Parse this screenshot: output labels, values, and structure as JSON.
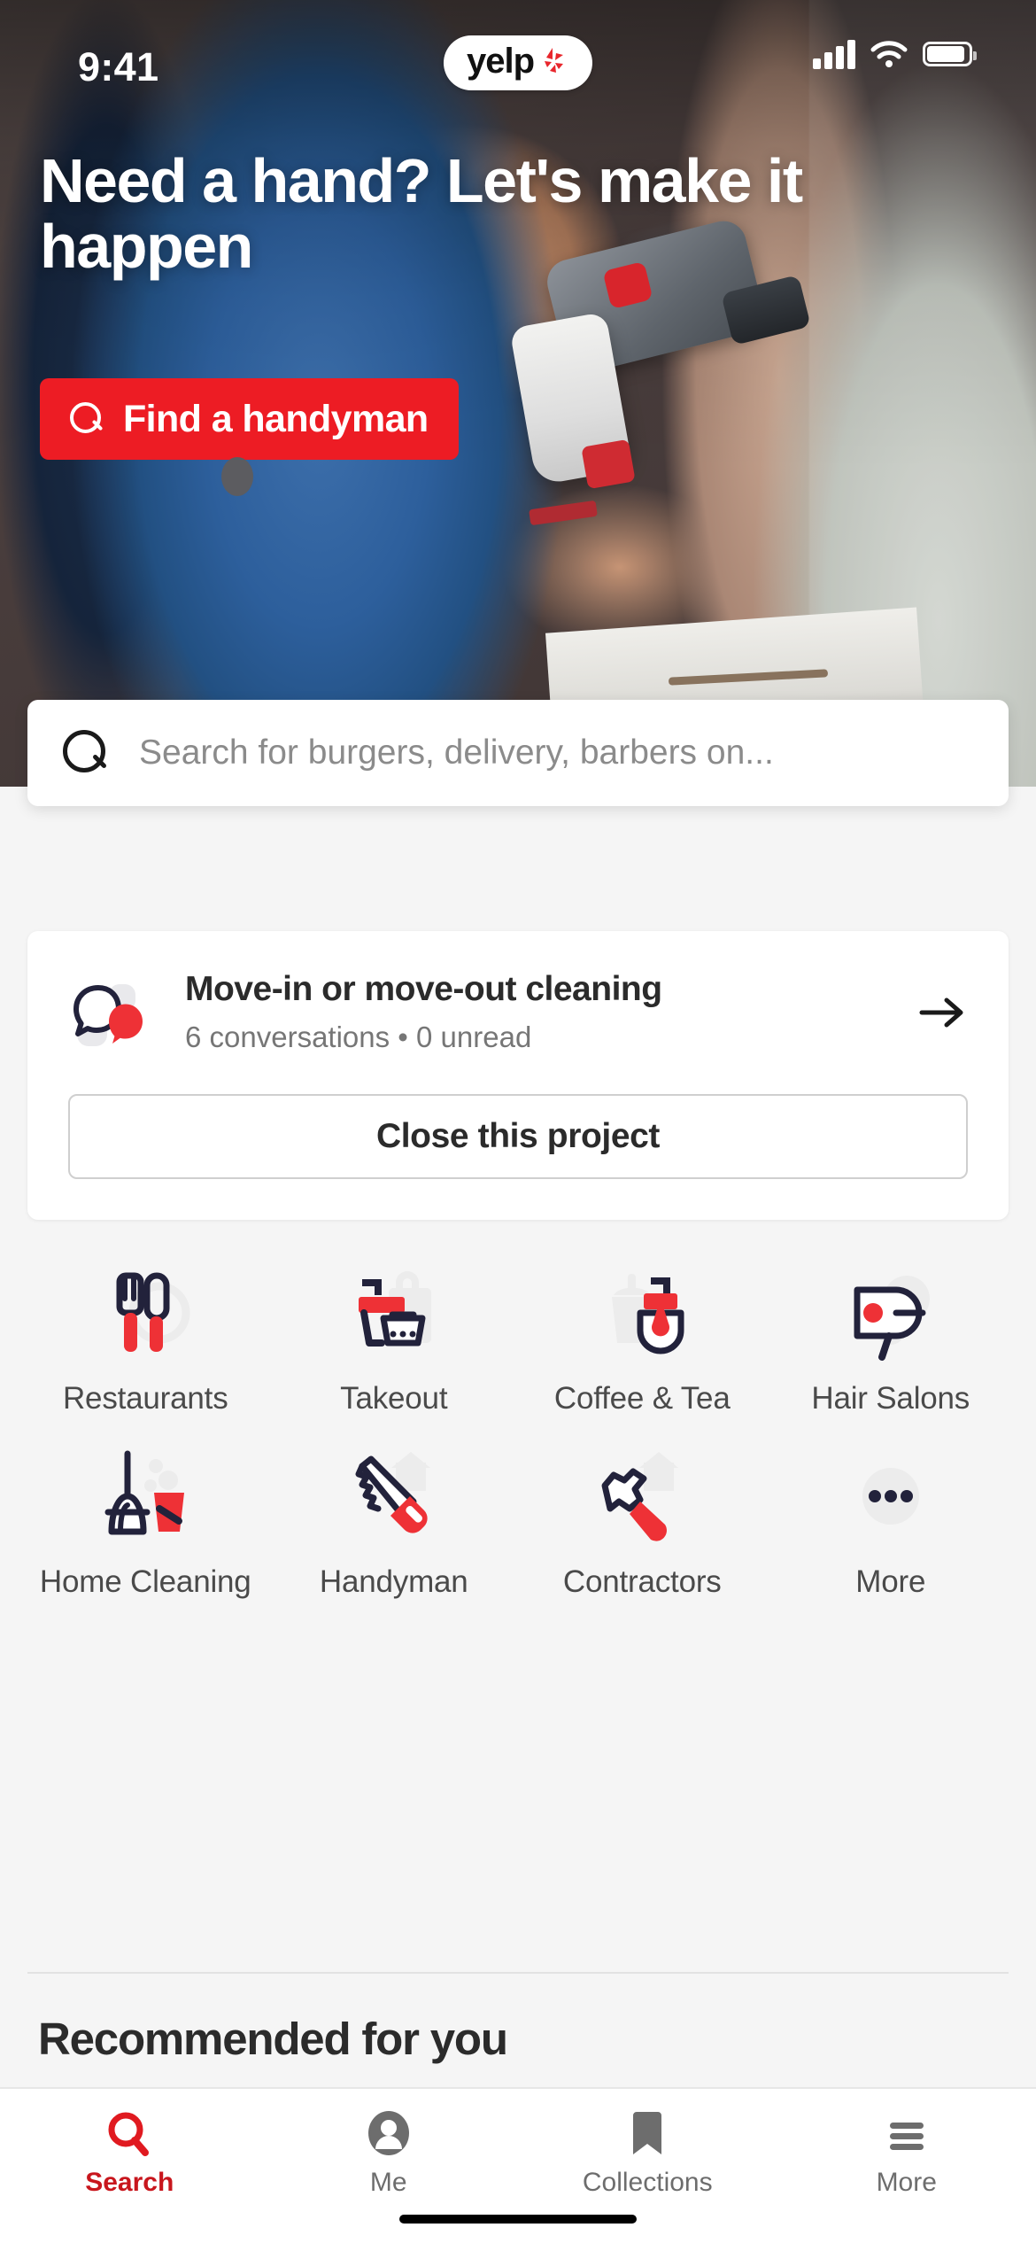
{
  "status_bar": {
    "time": "9:41",
    "app_badge": "yelp",
    "signal_icon": "cellular-signal-icon",
    "wifi_icon": "wifi-icon",
    "battery_icon": "battery-icon"
  },
  "hero": {
    "title": "Need a hand? Let's make it happen",
    "cta_label": "Find a handyman",
    "cta_icon": "search-icon",
    "cta_color": "#ed1c24"
  },
  "search": {
    "icon": "search-icon",
    "placeholder": "Search for burgers, delivery, barbers on..."
  },
  "project_card": {
    "icon": "chat-bubbles-icon",
    "title": "Move-in or move-out cleaning",
    "subtitle": "6 conversations • 0 unread",
    "arrow_icon": "arrow-right-icon",
    "close_label": "Close this project"
  },
  "categories": [
    {
      "label": "Restaurants",
      "icon": "fork-knife-icon"
    },
    {
      "label": "Takeout",
      "icon": "takeout-bag-icon"
    },
    {
      "label": "Coffee & Tea",
      "icon": "coffee-cup-icon"
    },
    {
      "label": "Hair Salons",
      "icon": "hair-dryer-icon"
    },
    {
      "label": "Home Cleaning",
      "icon": "broom-bucket-icon"
    },
    {
      "label": "Handyman",
      "icon": "handsaw-icon"
    },
    {
      "label": "Contractors",
      "icon": "hammer-icon"
    },
    {
      "label": "More",
      "icon": "ellipsis-icon"
    }
  ],
  "recommended": {
    "heading": "Recommended for you"
  },
  "tabbar": {
    "tabs": [
      {
        "label": "Search",
        "icon": "search-icon",
        "active": true
      },
      {
        "label": "Me",
        "icon": "person-icon",
        "active": false
      },
      {
        "label": "Collections",
        "icon": "bookmark-icon",
        "active": false
      },
      {
        "label": "More",
        "icon": "hamburger-menu-icon",
        "active": false
      }
    ],
    "active_color": "#c8161d",
    "inactive_color": "#6d6d6d"
  },
  "colors": {
    "brand_red": "#ed1c24",
    "icon_dark": "#2b2b3d",
    "icon_red": "#ee3136",
    "icon_grey": "#e8e8e8"
  }
}
